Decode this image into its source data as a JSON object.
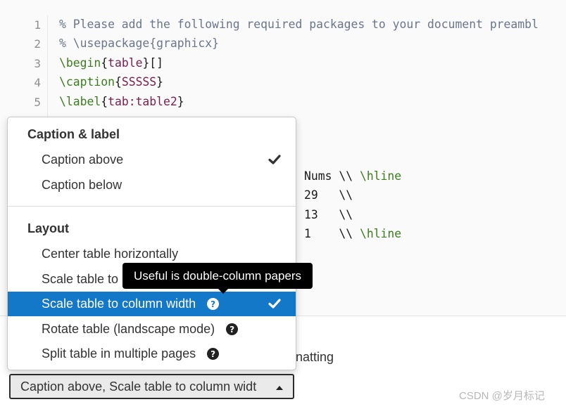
{
  "editor": {
    "line_numbers": [
      "1",
      "2",
      "3",
      "4",
      "5"
    ],
    "lines": [
      [
        {
          "t": "% Please add the following required packages to your document preambl",
          "k": "comment"
        }
      ],
      [
        {
          "t": "% \\usepackage{graphicx}",
          "k": "comment"
        }
      ],
      [
        {
          "t": "\\begin",
          "k": "cmd"
        },
        {
          "t": "{",
          "k": "brace"
        },
        {
          "t": "table",
          "k": "arg"
        },
        {
          "t": "}[]",
          "k": "brace"
        }
      ],
      [
        {
          "t": "\\caption",
          "k": "cmd"
        },
        {
          "t": "{",
          "k": "brace"
        },
        {
          "t": "SSSSS",
          "k": "arg"
        },
        {
          "t": "}",
          "k": "brace"
        }
      ],
      [
        {
          "t": "\\label",
          "k": "cmd"
        },
        {
          "t": "{",
          "k": "brace"
        },
        {
          "t": "tab:table2",
          "k": "arg"
        },
        {
          "t": "}",
          "k": "brace"
        }
      ]
    ],
    "fragments": [
      [
        {
          "t": "Nums \\\\ ",
          "k": "plain"
        },
        {
          "t": "\\hline",
          "k": "cmd"
        }
      ],
      [
        {
          "t": "29   \\\\",
          "k": "plain"
        }
      ],
      [
        {
          "t": "13   \\\\",
          "k": "plain"
        }
      ],
      [
        {
          "t": "1    \\\\ ",
          "k": "plain"
        },
        {
          "t": "\\hline",
          "k": "cmd"
        }
      ]
    ]
  },
  "menu": {
    "section1_title": "Caption & label",
    "caption_above": "Caption above",
    "caption_below": "Caption below",
    "section2_title": "Layout",
    "center_table": "Center table horizontally",
    "scale_text_width": "Scale table to",
    "scale_column_width": "Scale table to column width",
    "rotate_table": "Rotate table (landscape mode)",
    "split_table": "Split table in multiple pages",
    "help_glyph": "?"
  },
  "tooltip": {
    "text": "Useful is double-column papers"
  },
  "dropdown": {
    "label": "Caption above, Scale table to column widt"
  },
  "behind_text": {
    "formatting_fragment": "natting"
  },
  "watermark": "CSDN @岁月标记",
  "colors": {
    "accent": "#1478c8",
    "comment": "#6a7689",
    "command": "#3b7d1d",
    "argument": "#7a1e4a"
  },
  "icons": {
    "check": "checkmark-icon",
    "help": "help-circle-icon",
    "caret": "caret-up-icon"
  }
}
